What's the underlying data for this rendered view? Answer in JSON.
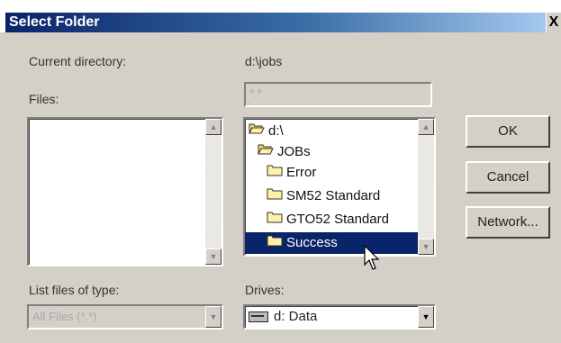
{
  "window": {
    "title": "Select Folder",
    "close_label": "X"
  },
  "labels": {
    "current_directory": "Current directory:",
    "current_directory_value": "d:\\jobs",
    "files": "Files:",
    "list_files_of_type": "List files of type:",
    "drives": "Drives:"
  },
  "filename_field": {
    "value": "*.*"
  },
  "directories": [
    {
      "name": "d:\\",
      "icon": "open-folder-icon"
    },
    {
      "name": "JOBs",
      "icon": "open-folder-icon"
    },
    {
      "name": "Error",
      "icon": "folder-icon"
    },
    {
      "name": "SM52 Standard",
      "icon": "folder-icon"
    },
    {
      "name": "GTO52 Standard",
      "icon": "folder-icon"
    },
    {
      "name": "Success",
      "icon": "folder-icon",
      "selected": true
    }
  ],
  "file_type": {
    "value": "All Files (*.*)"
  },
  "drive": {
    "value": "d: Data"
  },
  "buttons": {
    "ok": "OK",
    "cancel": "Cancel",
    "network": "Network..."
  },
  "colors": {
    "title_bar": "#0a246a",
    "selection": "#0a246a",
    "dialog_bg": "#d4d0c8"
  }
}
